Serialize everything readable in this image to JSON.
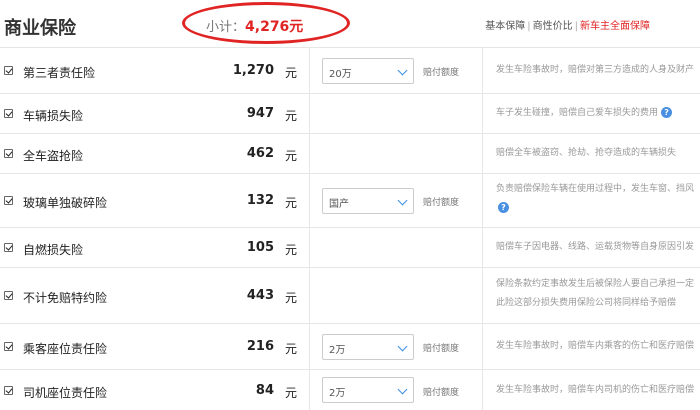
{
  "header": {
    "title": "商业保险",
    "subtotal_label": "小计：",
    "subtotal_amount": "4,276元",
    "plans": [
      "基本保障",
      "商性价比",
      "新车主全面保障"
    ],
    "plan_separator": "|"
  },
  "colors": {
    "accent_red": "#e02323",
    "help_blue": "#4a90e2",
    "chevron_blue": "#3a8ee6"
  },
  "rows": [
    {
      "name": "第三者责任险",
      "price": "1,270",
      "unit": "元",
      "select": "20万",
      "select_label": "赔付额度",
      "desc": [
        "发生车险事故时，赔偿对第三方造成的人身及财产"
      ]
    },
    {
      "name": "车辆损失险",
      "price": "947",
      "unit": "元",
      "desc": [
        "车子发生碰撞，赔偿自己爱车损失的费用"
      ]
    },
    {
      "name": "全车盗抢险",
      "price": "462",
      "unit": "元",
      "desc": [
        "赔偿全车被盗窃、抢劫、抢夺造成的车辆损失"
      ]
    },
    {
      "name": "玻璃单独破碎险",
      "price": "132",
      "unit": "元",
      "select": "国产",
      "select_label": "赔付额度",
      "desc": [
        "负责赔偿保险车辆在使用过程中，发生车窗、挡风"
      ]
    },
    {
      "name": "自燃损失险",
      "price": "105",
      "unit": "元",
      "desc": [
        "赔偿车子因电器、线路、运载货物等自身原因引发"
      ]
    },
    {
      "name": "不计免赔特约险",
      "price": "443",
      "unit": "元",
      "desc": [
        "保险条款约定事故发生后被保险人要自己承担一定",
        "此险这部分损失费用保险公司将同样给予赔偿"
      ]
    },
    {
      "name": "乘客座位责任险",
      "price": "216",
      "unit": "元",
      "select": "2万",
      "select_label": "赔付额度",
      "desc": [
        "发生车险事故时，赔偿车内乘客的伤亡和医疗赔偿"
      ]
    },
    {
      "name": "司机座位责任险",
      "price": "84",
      "unit": "元",
      "select": "2万",
      "select_label": "赔付额度",
      "desc": [
        "发生车险事故时，赔偿车内司机的伤亡和医疗赔偿"
      ]
    }
  ]
}
